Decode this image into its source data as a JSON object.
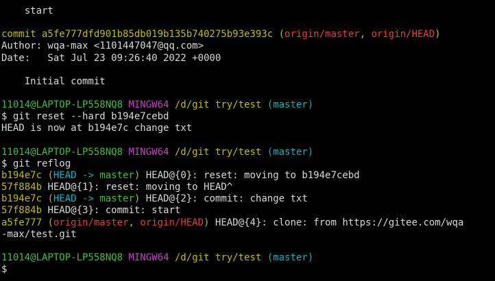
{
  "colors": {
    "background": "#000000",
    "default": "#d9d9d9",
    "yellow": "#bfbf00",
    "red": "#e13d3d",
    "cyan": "#00b7c3",
    "green": "#3fbf3f",
    "magenta": "#c046c0"
  },
  "terminal": {
    "lines": [
      {
        "segments": [
          {
            "text": "    start",
            "color": "default"
          }
        ]
      },
      {
        "segments": []
      },
      {
        "segments": [
          {
            "text": "commit a5fe777dfd901b85db019b135b740275b93e393c ",
            "color": "yellow"
          },
          {
            "text": "(",
            "color": "yellow"
          },
          {
            "text": "origin/master",
            "color": "red"
          },
          {
            "text": ", ",
            "color": "yellow"
          },
          {
            "text": "origin/HEAD",
            "color": "red"
          },
          {
            "text": ")",
            "color": "yellow"
          }
        ]
      },
      {
        "segments": [
          {
            "text": "Author: wqa-max <1101447047@qq.com>",
            "color": "default"
          }
        ]
      },
      {
        "segments": [
          {
            "text": "Date:   Sat Jul 23 09:26:40 2022 +0000",
            "color": "default"
          }
        ]
      },
      {
        "segments": []
      },
      {
        "segments": [
          {
            "text": "    Initial commit",
            "color": "default"
          }
        ]
      },
      {
        "segments": []
      },
      {
        "segments": [
          {
            "text": "11014@LAPTOP-LP558NQ8 ",
            "color": "green"
          },
          {
            "text": "MINGW64 ",
            "color": "magenta"
          },
          {
            "text": "/d/git try/test ",
            "color": "yellow"
          },
          {
            "text": "(master)",
            "color": "cyan"
          }
        ]
      },
      {
        "segments": [
          {
            "text": "$ git reset --hard b194e7cebd",
            "color": "default"
          }
        ]
      },
      {
        "segments": [
          {
            "text": "HEAD is now at b194e7c change txt",
            "color": "default"
          }
        ]
      },
      {
        "segments": []
      },
      {
        "segments": [
          {
            "text": "11014@LAPTOP-LP558NQ8 ",
            "color": "green"
          },
          {
            "text": "MINGW64 ",
            "color": "magenta"
          },
          {
            "text": "/d/git try/test ",
            "color": "yellow"
          },
          {
            "text": "(master)",
            "color": "cyan"
          }
        ]
      },
      {
        "segments": [
          {
            "text": "$ git reflog",
            "color": "default"
          }
        ]
      },
      {
        "segments": [
          {
            "text": "b194e7c ",
            "color": "yellow"
          },
          {
            "text": "(",
            "color": "yellow"
          },
          {
            "text": "HEAD -> ",
            "color": "cyan"
          },
          {
            "text": "master",
            "color": "green"
          },
          {
            "text": ") ",
            "color": "yellow"
          },
          {
            "text": "HEAD@{0}: reset: moving to b194e7cebd",
            "color": "default"
          }
        ]
      },
      {
        "segments": [
          {
            "text": "57f884b ",
            "color": "yellow"
          },
          {
            "text": "HEAD@{1}: reset: moving to HEAD^",
            "color": "default"
          }
        ]
      },
      {
        "segments": [
          {
            "text": "b194e7c ",
            "color": "yellow"
          },
          {
            "text": "(",
            "color": "yellow"
          },
          {
            "text": "HEAD -> ",
            "color": "cyan"
          },
          {
            "text": "master",
            "color": "green"
          },
          {
            "text": ") ",
            "color": "yellow"
          },
          {
            "text": "HEAD@{2}: commit: change txt",
            "color": "default"
          }
        ]
      },
      {
        "segments": [
          {
            "text": "57f884b ",
            "color": "yellow"
          },
          {
            "text": "HEAD@{3}: commit: start",
            "color": "default"
          }
        ]
      },
      {
        "segments": [
          {
            "text": "a5fe777 ",
            "color": "yellow"
          },
          {
            "text": "(",
            "color": "yellow"
          },
          {
            "text": "origin/master",
            "color": "red"
          },
          {
            "text": ", ",
            "color": "yellow"
          },
          {
            "text": "origin/HEAD",
            "color": "red"
          },
          {
            "text": ") ",
            "color": "yellow"
          },
          {
            "text": "HEAD@{4}: clone: from https://gitee.com/wqa",
            "color": "default"
          }
        ]
      },
      {
        "segments": [
          {
            "text": "-max/test.git",
            "color": "default"
          }
        ]
      },
      {
        "segments": []
      },
      {
        "segments": [
          {
            "text": "11014@LAPTOP-LP558NQ8 ",
            "color": "green"
          },
          {
            "text": "MINGW64 ",
            "color": "magenta"
          },
          {
            "text": "/d/git try/test ",
            "color": "yellow"
          },
          {
            "text": "(master)",
            "color": "cyan"
          }
        ]
      },
      {
        "segments": [
          {
            "text": "$",
            "color": "default"
          }
        ]
      }
    ]
  }
}
